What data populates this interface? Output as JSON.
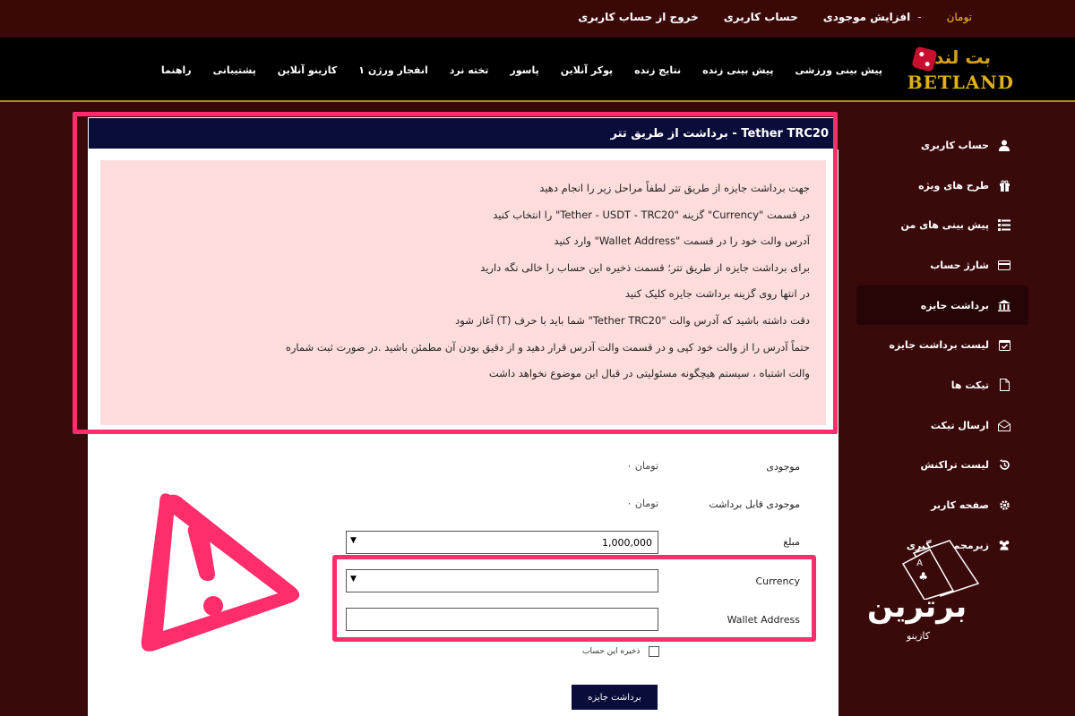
{
  "topbar": {
    "currency": "تومان",
    "dash": "-",
    "links": [
      "افزایش موجودی",
      "حساب کاربری",
      "خروج از حساب کاربری"
    ]
  },
  "logo": {
    "fa": "بت لند",
    "en": "BETLAND"
  },
  "nav": [
    "پیش بینی ورزشی",
    "پیش بینی زنده",
    "نتایج زنده",
    "پوکر آنلاین",
    "پاسور",
    "تخته نرد",
    "انفجار ورژن ۱",
    "کازینو آنلاین",
    "پشتیبانی",
    "راهنما"
  ],
  "sidebar": {
    "items": [
      {
        "label": "حساب کاربری",
        "icon": "user-icon"
      },
      {
        "label": "طرح های ویژه",
        "icon": "gift-icon"
      },
      {
        "label": "پیش بینی های من",
        "icon": "list-icon"
      },
      {
        "label": "شارژ حساب",
        "icon": "card-icon"
      },
      {
        "label": "برداشت جایزه",
        "icon": "bank-icon",
        "active": true
      },
      {
        "label": "لیست برداشت جایزه",
        "icon": "calendar-check-icon"
      },
      {
        "label": "تیکت ها",
        "icon": "file-icon"
      },
      {
        "label": "ارسال تیکت",
        "icon": "envelope-open-icon"
      },
      {
        "label": "لیست تراکنش",
        "icon": "history-icon"
      },
      {
        "label": "صفحه کاربر",
        "icon": "gear-icon"
      },
      {
        "label": "زیرمجموعه گیری",
        "icon": "users-icon"
      }
    ]
  },
  "panel": {
    "title": "Tether TRC20 - برداشت از طریق تتر",
    "lines": [
      "جهت برداشت جایزه از طریق تتر لطفاً مراحل زیر را انجام دهید",
      "در قسمت \"Currency\" گزینه \"Tether - USDT - TRC20\" را انتخاب کنید",
      "آدرس والت خود را در قسمت \"Wallet Address\" وارد کنید",
      "برای برداشت جایزه از طریق تتر؛ قسمت ذخیره این حساب را خالی نگه دارید",
      "در انتها روی گزینه برداشت جایزه کلیک کنید",
      "دقت داشته باشید که آدرس والت \"Tether TRC20\" شما باید با حرف (T) آغاز شود",
      "حتماً آدرس را از والت خود کپی و در قسمت والت آدرس قرار دهید و از دقیق بودن آن مطمئن باشید .در صورت ثبت شماره",
      "والت اشتباه ، سیستم هیچگونه مسئولیتی در قبال این موضوع نخواهد داشت"
    ]
  },
  "form": {
    "balance_label": "موجودی",
    "balance_value": "تومان ۰",
    "withdrawable_label": "موجودی قابل برداشت",
    "withdrawable_value": "تومان ۰",
    "amount_label": "مبلغ",
    "amount_value": "1,000,000",
    "currency_label": "Currency",
    "currency_value": "",
    "wallet_label": "Wallet Address",
    "wallet_value": "",
    "save_label": "ذخیره این حساب",
    "submit_label": "برداشت جایزه"
  },
  "brand": {
    "big": "برترین",
    "small": "کازینو"
  },
  "colors": {
    "accent": "#ff2d6b",
    "navy": "#0a0c3a",
    "maroon": "#3b0808",
    "gold": "#e0b01c"
  }
}
